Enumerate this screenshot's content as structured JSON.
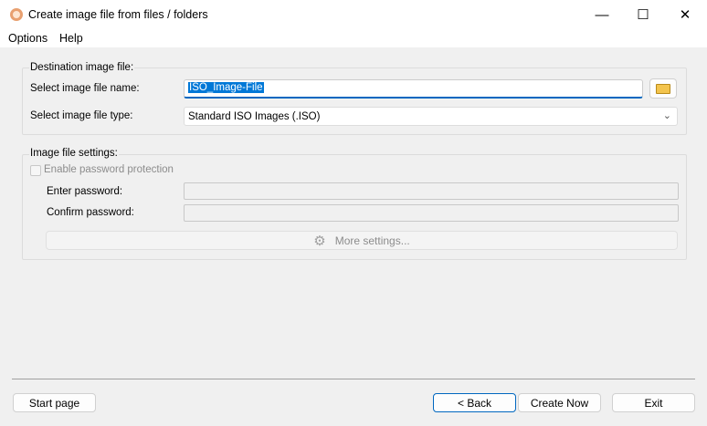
{
  "window": {
    "title": "Create image file from files / folders",
    "minimize": "—",
    "maximize": "☐",
    "close": "✕"
  },
  "menu": {
    "options": "Options",
    "help": "Help"
  },
  "destination": {
    "group_label": "Destination image file:",
    "name_label": "Select image file name:",
    "name_value": "ISO_Image-File",
    "type_label": "Select image file type:",
    "type_value": "Standard ISO Images (.ISO)"
  },
  "settings": {
    "group_label": "Image file settings:",
    "enable_password": "Enable password protection",
    "enter_password": "Enter password:",
    "confirm_password": "Confirm password:",
    "more_settings": "More settings..."
  },
  "buttons": {
    "start_page": "Start page",
    "back": "< Back",
    "create_now": "Create Now",
    "exit": "Exit"
  }
}
